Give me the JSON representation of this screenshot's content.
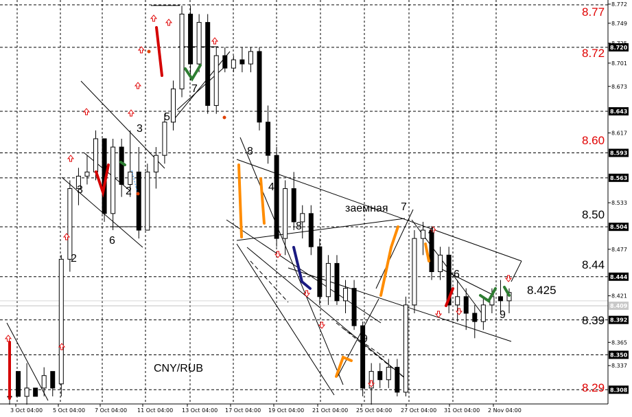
{
  "chart_data": {
    "type": "candlestick",
    "symbol": "CNY/RUB",
    "ylim": [
      8.295,
      8.772
    ],
    "x_ticks": [
      "3 Oct 04:00",
      "5 Oct 04:00",
      "7 Oct 04:00",
      "11 Oct 04:00",
      "13 Oct 04:00",
      "17 Oct 04:00",
      "19 Oct 04:00",
      "21 Oct 04:00",
      "25 Oct 04:00",
      "27 Oct 04:00",
      "31 Oct 04:00",
      "2 Nov 04:00"
    ],
    "y_axis_ticks": [
      "8.772",
      "8.749",
      "8.725",
      "8.701",
      "8.673",
      "8.617",
      "8.533",
      "8.477",
      "8.421",
      "8.365",
      "8.337"
    ],
    "y_axis_boxed": [
      "8.720",
      "8.643",
      "8.593",
      "8.563",
      "8.504",
      "8.444",
      "8.409",
      "8.392",
      "8.350",
      "8.308"
    ],
    "levels_red": [
      "8.77",
      "8.72",
      "8.60",
      "8.29"
    ],
    "levels_black": [
      "8.50",
      "8.44",
      "8.39"
    ],
    "annotations": {
      "price_label": "8.425",
      "word_label": "заемная",
      "wave_numbers": [
        "3",
        "2",
        "6",
        "2",
        "3",
        "5",
        "7",
        "8",
        "4",
        "8",
        "7",
        "4",
        "6",
        "9",
        "9"
      ]
    },
    "candles": [
      [
        8.3,
        8.35,
        8.29,
        8.3
      ],
      [
        8.33,
        8.32,
        8.31,
        8.3
      ],
      [
        8.3,
        8.34,
        8.29,
        8.31
      ],
      [
        8.31,
        8.31,
        8.3,
        8.3
      ],
      [
        8.31,
        8.335,
        8.3,
        8.325
      ],
      [
        8.33,
        8.33,
        8.3,
        8.31
      ],
      [
        8.315,
        8.47,
        8.3,
        8.465
      ],
      [
        8.465,
        8.56,
        8.45,
        8.55
      ],
      [
        8.55,
        8.575,
        8.53,
        8.565
      ],
      [
        8.565,
        8.59,
        8.555,
        8.57
      ],
      [
        8.57,
        8.62,
        8.56,
        8.61
      ],
      [
        8.61,
        8.6,
        8.51,
        8.52
      ],
      [
        8.52,
        8.61,
        8.5,
        8.6
      ],
      [
        8.6,
        8.61,
        8.54,
        8.555
      ],
      [
        8.555,
        8.62,
        8.54,
        8.57
      ],
      [
        8.57,
        8.6,
        8.49,
        8.5
      ],
      [
        8.5,
        8.58,
        8.5,
        8.57
      ],
      [
        8.57,
        8.6,
        8.55,
        8.59
      ],
      [
        8.59,
        8.64,
        8.58,
        8.63
      ],
      [
        8.63,
        8.68,
        8.62,
        8.67
      ],
      [
        8.67,
        8.77,
        8.66,
        8.76
      ],
      [
        8.76,
        8.77,
        8.68,
        8.7
      ],
      [
        8.7,
        8.76,
        8.69,
        8.75
      ],
      [
        8.75,
        8.76,
        8.64,
        8.65
      ],
      [
        8.65,
        8.72,
        8.64,
        8.71
      ],
      [
        8.71,
        8.72,
        8.69,
        8.695
      ],
      [
        8.695,
        8.71,
        8.69,
        8.705
      ],
      [
        8.705,
        8.72,
        8.69,
        8.7
      ],
      [
        8.7,
        8.72,
        8.69,
        8.715
      ],
      [
        8.715,
        8.72,
        8.62,
        8.63
      ],
      [
        8.63,
        8.65,
        8.58,
        8.59
      ],
      [
        8.59,
        8.6,
        8.48,
        8.49
      ],
      [
        8.49,
        8.56,
        8.47,
        8.55
      ],
      [
        8.55,
        8.57,
        8.5,
        8.51
      ],
      [
        8.51,
        8.53,
        8.49,
        8.52
      ],
      [
        8.52,
        8.53,
        8.47,
        8.48
      ],
      [
        8.48,
        8.49,
        8.41,
        8.42
      ],
      [
        8.42,
        8.47,
        8.41,
        8.46
      ],
      [
        8.46,
        8.47,
        8.41,
        8.415
      ],
      [
        8.415,
        8.44,
        8.4,
        8.43
      ],
      [
        8.43,
        8.44,
        8.38,
        8.385
      ],
      [
        8.385,
        8.39,
        8.3,
        8.31
      ],
      [
        8.31,
        8.34,
        8.29,
        8.33
      ],
      [
        8.33,
        8.34,
        8.31,
        8.32
      ],
      [
        8.32,
        8.345,
        8.31,
        8.335
      ],
      [
        8.335,
        8.345,
        8.3,
        8.305
      ],
      [
        8.305,
        8.42,
        8.3,
        8.41
      ],
      [
        8.41,
        8.5,
        8.4,
        8.49
      ],
      [
        8.49,
        8.51,
        8.47,
        8.5
      ],
      [
        8.5,
        8.505,
        8.44,
        8.45
      ],
      [
        8.45,
        8.48,
        8.44,
        8.47
      ],
      [
        8.47,
        8.48,
        8.4,
        8.41
      ],
      [
        8.41,
        8.44,
        8.39,
        8.42
      ],
      [
        8.42,
        8.43,
        8.38,
        8.4
      ],
      [
        8.4,
        8.41,
        8.37,
        8.39
      ],
      [
        8.39,
        8.42,
        8.38,
        8.41
      ],
      [
        8.41,
        8.43,
        8.4,
        8.42
      ],
      [
        8.42,
        8.44,
        8.4,
        8.415
      ],
      [
        8.415,
        8.43,
        8.4,
        8.425
      ]
    ]
  }
}
